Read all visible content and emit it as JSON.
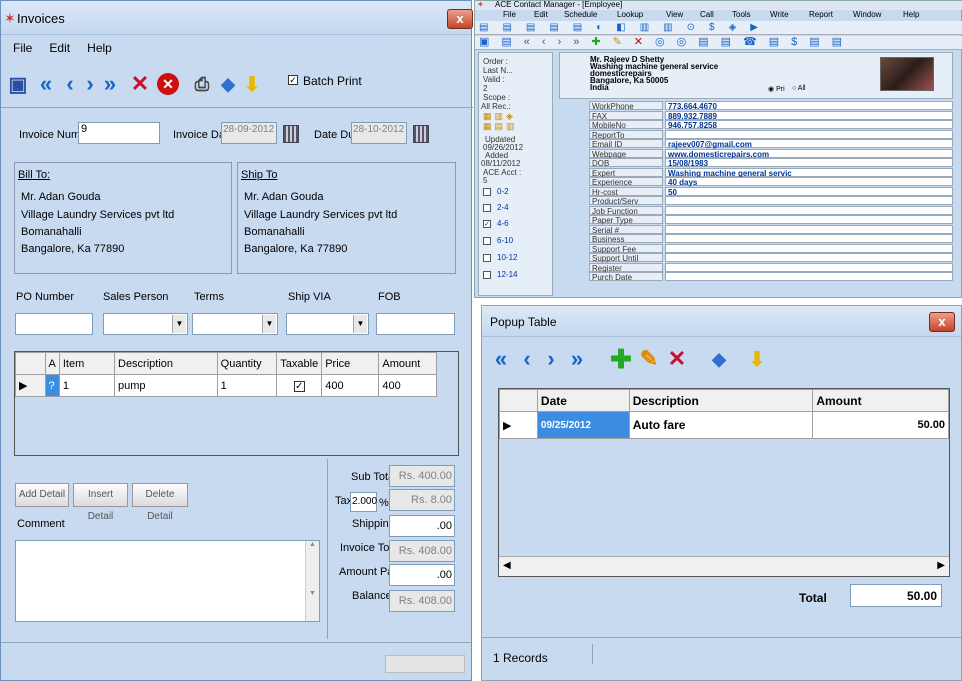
{
  "invoices": {
    "title": "Invoices",
    "close": "x",
    "menu": [
      "File",
      "Edit",
      "Help"
    ],
    "batch_print_label": "Batch Print",
    "invoice_number_label": "Invoice Number",
    "invoice_number": "9",
    "invoice_date_label": "Invoice Date",
    "invoice_date": "28-09-2012",
    "date_due_label": "Date Due",
    "date_due": "28-10-2012",
    "bill_to_label": "Bill To:",
    "bill_to": [
      "Mr. Adan Gouda",
      "Village Laundry Services pvt ltd",
      "Bomanahalli",
      "Bangalore, Ka 77890"
    ],
    "ship_to_label": "Ship To",
    "ship_to": [
      "Mr. Adan Gouda",
      "Village Laundry Services pvt ltd",
      "Bomanahalli",
      "Bangalore, Ka 77890"
    ],
    "po_number_label": "PO Number",
    "sales_person_label": "Sales Person",
    "terms_label": "Terms",
    "ship_via_label": "Ship VIA",
    "fob_label": "FOB",
    "grid_headers": [
      "A",
      "Item",
      "Description",
      "Quantity",
      "Taxable",
      "Price",
      "Amount"
    ],
    "grid_row": {
      "a": "?",
      "item": "1",
      "description": "pump",
      "quantity": "1",
      "price": "400",
      "amount": "400"
    },
    "add_detail": "Add Detail",
    "insert_detail": "Insert Detail",
    "delete_detail": "Delete Detail",
    "comment_label": "Comment",
    "sub_total_label": "Sub Total",
    "sub_total": "Rs. 400.00",
    "tax_label": "Tax",
    "tax_rate": "2.000",
    "tax_pct": "%",
    "tax_amount": "Rs. 8.00",
    "shipping_label": "Shipping",
    "shipping": ".00",
    "invoice_total_label": "Invoice Total",
    "invoice_total": "Rs. 408.00",
    "amount_paid_label": "Amount Paid",
    "amount_paid": ".00",
    "balance_label": "Balance",
    "balance": "Rs. 408.00"
  },
  "ace": {
    "title": "ACE Contact Manager - [Employee]",
    "menu": [
      "File",
      "Edit",
      "Schedule",
      "Lookup",
      "View",
      "Call",
      "Tools",
      "Write",
      "Report",
      "Window",
      "Help"
    ],
    "left_labels": [
      "Order :",
      "Last N...",
      "Valid :",
      "2",
      "Scope :",
      "All Rec.:",
      "Updated",
      "09/26/2012",
      "Added",
      "08/11/2012",
      "ACE Acct :",
      "5"
    ],
    "ranges": [
      "0-2",
      "2-4",
      "4-6",
      "6-10",
      "10-12",
      "12-14"
    ],
    "address": [
      "Mr. Rajeev D Shetty",
      "Washing machine general service",
      "domesticrepairs",
      "Bangalore, Ka 50005",
      "India"
    ],
    "pri_label": "Pri",
    "all_label": "All",
    "fields": [
      {
        "k": "WorkPhone",
        "v": "773.664.4670"
      },
      {
        "k": "FAX",
        "v": "889.932.7889"
      },
      {
        "k": "MobileNo",
        "v": "946.757.8258"
      },
      {
        "k": "ReportTo",
        "v": ""
      },
      {
        "k": "Email ID",
        "v": "rajeev007@gmail.com"
      },
      {
        "k": "Webpage",
        "v": "www.domesticrepairs.com"
      },
      {
        "k": "DOB",
        "v": "15/08/1983"
      },
      {
        "k": "Expert",
        "v": "Washing machine general servic"
      },
      {
        "k": "Experience",
        "v": "40 days"
      },
      {
        "k": "Hr-cost",
        "v": "50"
      },
      {
        "k": "Product/Serv",
        "v": ""
      },
      {
        "k": "Job Function",
        "v": ""
      },
      {
        "k": "Paper Type",
        "v": ""
      },
      {
        "k": "Serial #",
        "v": ""
      },
      {
        "k": "Business",
        "v": ""
      },
      {
        "k": "Support Fee",
        "v": ""
      },
      {
        "k": "Support Until",
        "v": ""
      },
      {
        "k": "Register",
        "v": ""
      },
      {
        "k": "Purch Date",
        "v": ""
      }
    ]
  },
  "popup": {
    "title": "Popup Table",
    "close": "x",
    "headers": [
      "Date",
      "Description",
      "Amount"
    ],
    "row": {
      "date": "09/25/2012",
      "description": "Auto fare",
      "amount": "50.00"
    },
    "total_label": "Total",
    "total": "50.00",
    "records": "1 Records"
  }
}
